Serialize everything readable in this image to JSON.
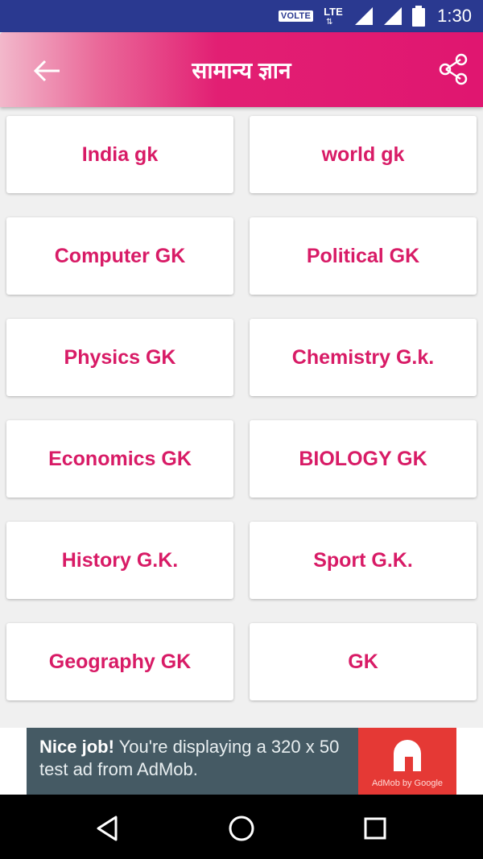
{
  "status_bar": {
    "volte": "VOLTE",
    "network": "LTE",
    "time": "1:30"
  },
  "app_bar": {
    "title": "सामान्य ज्ञान",
    "back_icon": "arrow-left-icon",
    "share_icon": "share-icon",
    "color_start": "#f2b8cb",
    "color_end": "#e01670"
  },
  "categories": [
    {
      "label": "India gk"
    },
    {
      "label": "world gk"
    },
    {
      "label": "Computer GK"
    },
    {
      "label": "Political GK"
    },
    {
      "label": "Physics GK"
    },
    {
      "label": "Chemistry G.k."
    },
    {
      "label": "Economics GK"
    },
    {
      "label": "BIOLOGY GK"
    },
    {
      "label": "History G.K."
    },
    {
      "label": "Sport G.K."
    },
    {
      "label": "Geography GK"
    },
    {
      "label": "GK"
    }
  ],
  "ad": {
    "headline": "Nice job!",
    "body": "You're displaying a 320 x 50 test ad from AdMob.",
    "logo_caption": "AdMob by Google"
  },
  "colors": {
    "accent": "#d81b66",
    "status_bar": "#2a3990",
    "ad_background": "#455a64",
    "ad_logo": "#e53935"
  }
}
